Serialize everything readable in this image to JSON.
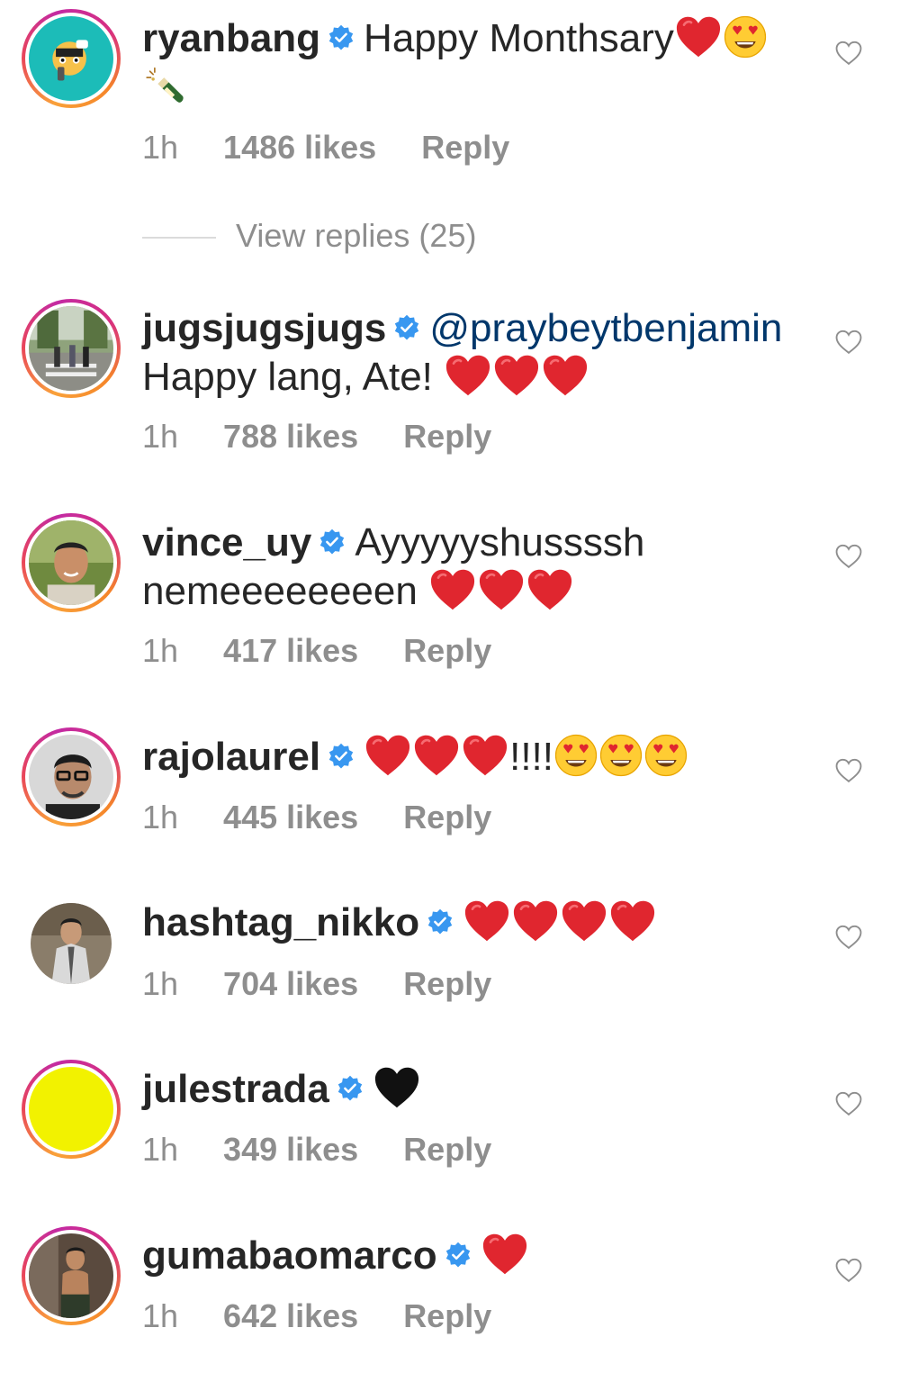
{
  "colors": {
    "verified": "#3897f0",
    "heart_red": "#e0262f",
    "meta_gray": "#8e8e8e",
    "text": "#262626"
  },
  "comments": [
    {
      "username": "ryanbang",
      "text": "Happy Monthsary",
      "emojis_after": [
        "red-heart",
        "heart-eyes",
        "champagne"
      ],
      "time": "1h",
      "likes": "1486 likes",
      "reply": "Reply"
    },
    {
      "username": "jugsjugsjugs",
      "mention": "@praybeytbenjamin",
      "text": "Happy lang, Ate!",
      "emojis_after": [
        "red-heart",
        "red-heart",
        "red-heart"
      ],
      "time": "1h",
      "likes": "788 likes",
      "reply": "Reply"
    },
    {
      "username": "vince_uy",
      "text": "Ayyyyyshussssh nemeeeeeeeen",
      "emojis_after": [
        "red-heart",
        "red-heart",
        "red-heart"
      ],
      "time": "1h",
      "likes": "417 likes",
      "reply": "Reply"
    },
    {
      "username": "rajolaurel",
      "text": "!!!!",
      "emojis_before": [
        "red-heart",
        "red-heart",
        "red-heart"
      ],
      "emojis_after": [
        "heart-eyes",
        "heart-eyes",
        "heart-eyes"
      ],
      "time": "1h",
      "likes": "445 likes",
      "reply": "Reply"
    },
    {
      "username": "hashtag_nikko",
      "emojis_after": [
        "red-heart",
        "red-heart",
        "red-heart",
        "red-heart"
      ],
      "time": "1h",
      "likes": "704 likes",
      "reply": "Reply"
    },
    {
      "username": "julestrada",
      "emojis_after": [
        "black-heart"
      ],
      "time": "1h",
      "likes": "349 likes",
      "reply": "Reply"
    },
    {
      "username": "gumabaomarco",
      "emojis_after": [
        "red-heart"
      ],
      "time": "1h",
      "likes": "642 likes",
      "reply": "Reply"
    }
  ],
  "view_replies": "View replies (25)"
}
